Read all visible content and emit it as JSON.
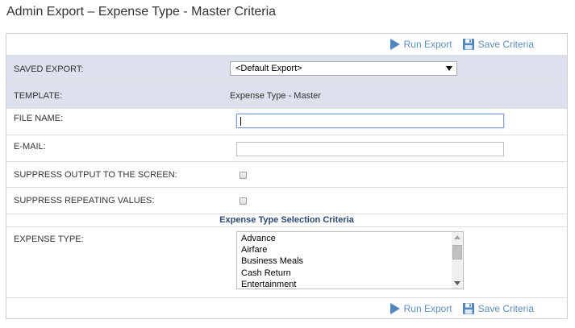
{
  "page": {
    "title": "Admin Export – Expense Type - Master Criteria"
  },
  "toolbar": {
    "run_export_label": "Run Export",
    "save_criteria_label": "Save Criteria",
    "accent_color": "#5b8fc9"
  },
  "form": {
    "saved_export": {
      "label": "SAVED EXPORT:",
      "selected": "<Default Export>"
    },
    "template": {
      "label": "TEMPLATE:",
      "value": "Expense Type - Master"
    },
    "file_name": {
      "label": "FILE NAME:",
      "value": ""
    },
    "email": {
      "label": "E-MAIL:",
      "value": ""
    },
    "suppress_output": {
      "label": "SUPPRESS OUTPUT TO THE SCREEN:",
      "checked": false
    },
    "suppress_repeating": {
      "label": "SUPPRESS REPEATING VALUES:",
      "checked": false
    }
  },
  "criteria": {
    "section_title": "Expense Type Selection Criteria",
    "expense_type": {
      "label": "EXPENSE TYPE:",
      "options": [
        "Advance",
        "Airfare",
        "Business Meals",
        "Cash Return",
        "Entertainment"
      ]
    }
  },
  "colors": {
    "shaded_row": "#dde1ee",
    "section_title": "#2d4a7a"
  }
}
